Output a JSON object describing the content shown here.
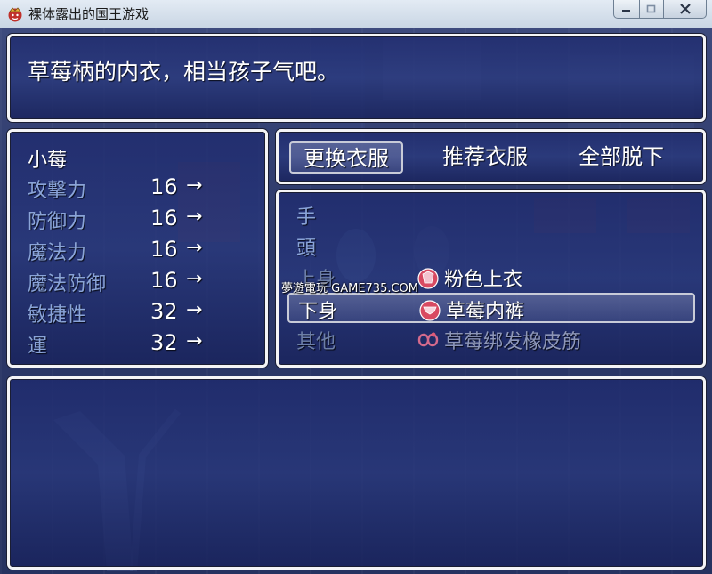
{
  "window": {
    "title": "裸体露出的国王游戏",
    "buttons": [
      "minimize",
      "maximize",
      "close"
    ]
  },
  "help": {
    "text": "草莓柄的内衣，相当孩子气吧。"
  },
  "actor": {
    "name": "小莓",
    "stats": [
      {
        "label": "攻撃力",
        "value": "16",
        "arrow": "→"
      },
      {
        "label": "防御力",
        "value": "16",
        "arrow": "→"
      },
      {
        "label": "魔法力",
        "value": "16",
        "arrow": "→"
      },
      {
        "label": "魔法防御",
        "value": "16",
        "arrow": "→"
      },
      {
        "label": "敏捷性",
        "value": "32",
        "arrow": "→"
      },
      {
        "label": "運",
        "value": "32",
        "arrow": "→"
      }
    ]
  },
  "commands": [
    {
      "label": "更换衣服",
      "selected": true
    },
    {
      "label": "推荐衣服",
      "selected": false
    },
    {
      "label": "全部脱下",
      "selected": false
    }
  ],
  "equipment": {
    "slots": [
      {
        "label": "手",
        "item": ""
      },
      {
        "label": "頭",
        "item": ""
      },
      {
        "label": "上身",
        "item": "粉色上衣",
        "icon": "clothing-icon"
      },
      {
        "label": "下身",
        "item": "草莓内裤",
        "icon": "clothing-icon",
        "selected": true
      },
      {
        "label": "其他",
        "item": "草莓绑发橡皮筋",
        "icon": "hair-tie-icon"
      }
    ]
  },
  "watermark": "夢遊電玩 GAME735.COM",
  "colors": {
    "window_bg": "#24306b",
    "window_border": "#f4f4f6",
    "system_text": "#8aa4d8",
    "normal_text": "#ffffff",
    "item_icon": "#e0607a"
  }
}
